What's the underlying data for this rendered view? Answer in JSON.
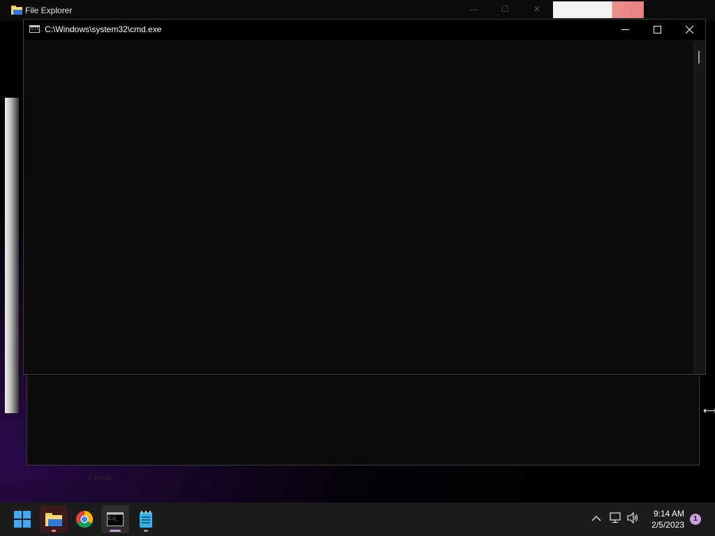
{
  "background_window": {
    "title": "File Explorer",
    "status_text": "7 items"
  },
  "cmd_window": {
    "title": "C:\\Windows\\system32\\cmd.exe",
    "icon_text": "C:\\_",
    "content": ""
  },
  "taskbar": {
    "apps": [
      {
        "name": "start-button",
        "icon": "windows-logo-icon"
      },
      {
        "name": "file-explorer",
        "icon": "folder-icon"
      },
      {
        "name": "chrome",
        "icon": "chrome-icon"
      },
      {
        "name": "command-prompt",
        "icon": "cmd-icon"
      },
      {
        "name": "notepad",
        "icon": "notepad-icon"
      }
    ],
    "time": "9:14 AM",
    "date": "2/5/2023",
    "notification_count": "1"
  },
  "colors": {
    "accent": "#c9a0dc",
    "taskbar": "#1c1c1c",
    "console_bg": "#0c0c0c"
  }
}
